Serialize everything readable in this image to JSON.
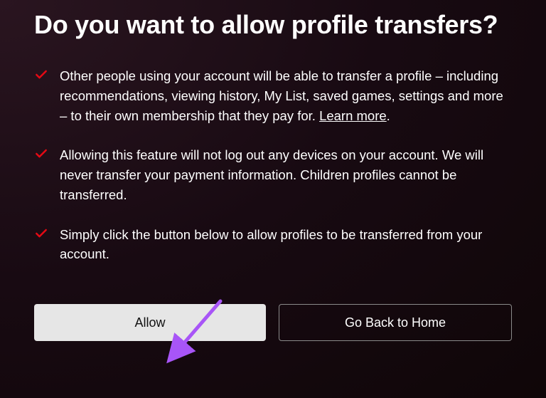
{
  "title": "Do you want to allow profile transfers?",
  "points": [
    {
      "text_before_link": "Other people using your account will be able to transfer a profile – including recommendations, viewing history, My List, saved games, settings and more – to their own membership that they pay for. ",
      "link_text": "Learn more",
      "text_after_link": "."
    },
    {
      "text_before_link": "Allowing this feature will not log out any devices on your account. We will never transfer your payment information. Children profiles cannot be transferred.",
      "link_text": "",
      "text_after_link": ""
    },
    {
      "text_before_link": "Simply click the button below to allow profiles to be transferred from your account.",
      "link_text": "",
      "text_after_link": ""
    }
  ],
  "buttons": {
    "primary": "Allow",
    "secondary": "Go Back to Home"
  },
  "colors": {
    "accent_check": "#e50914",
    "annotation_arrow": "#a855f7"
  }
}
